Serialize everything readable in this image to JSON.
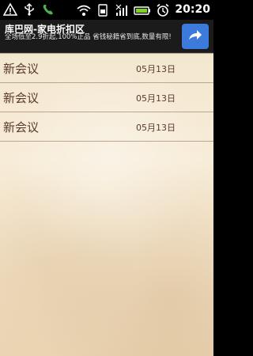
{
  "status_bar": {
    "time": "20:20",
    "icons": [
      "warning-icon",
      "usb-icon",
      "phone-icon",
      "wifi-icon",
      "sim-icon",
      "signal-icon",
      "battery-icon",
      "alarm-icon"
    ]
  },
  "ad": {
    "title": "库巴网-家电折扣区",
    "description": "全场低至2.9折起,100%正品 省钱秘籍省到底,数量有限!",
    "button_icon": "share-arrow-icon"
  },
  "meetings": [
    {
      "title": "新会议",
      "date": "05月13日"
    },
    {
      "title": "新会议",
      "date": "05月13日"
    },
    {
      "title": "新会议",
      "date": "05月13日"
    }
  ]
}
